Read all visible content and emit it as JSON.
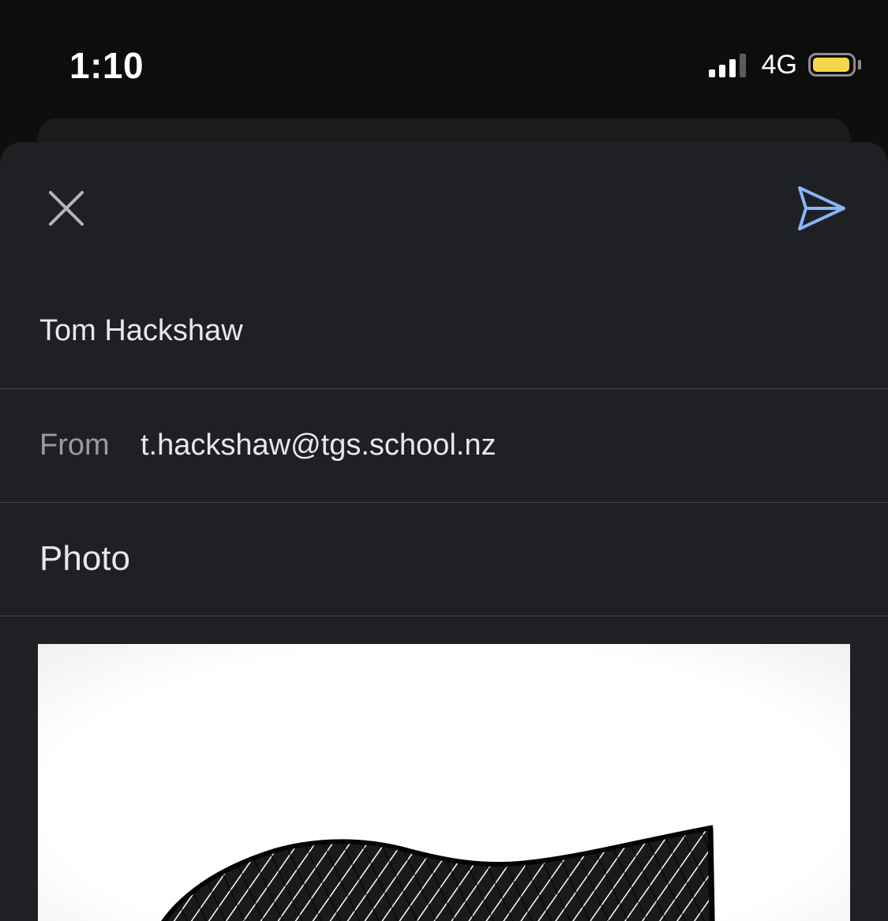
{
  "status_bar": {
    "time": "1:10",
    "network": "4G",
    "icons": [
      "signal-icon",
      "battery-icon"
    ],
    "battery_color": "#f5d54a"
  },
  "compose": {
    "close_icon": "close-icon",
    "send_icon": "send-icon",
    "accent_color": "#8ab4f8",
    "to": "Tom Hackshaw",
    "from_label": "From",
    "from_value": "t.hackshaw@tgs.school.nz",
    "subject": "Photo"
  }
}
